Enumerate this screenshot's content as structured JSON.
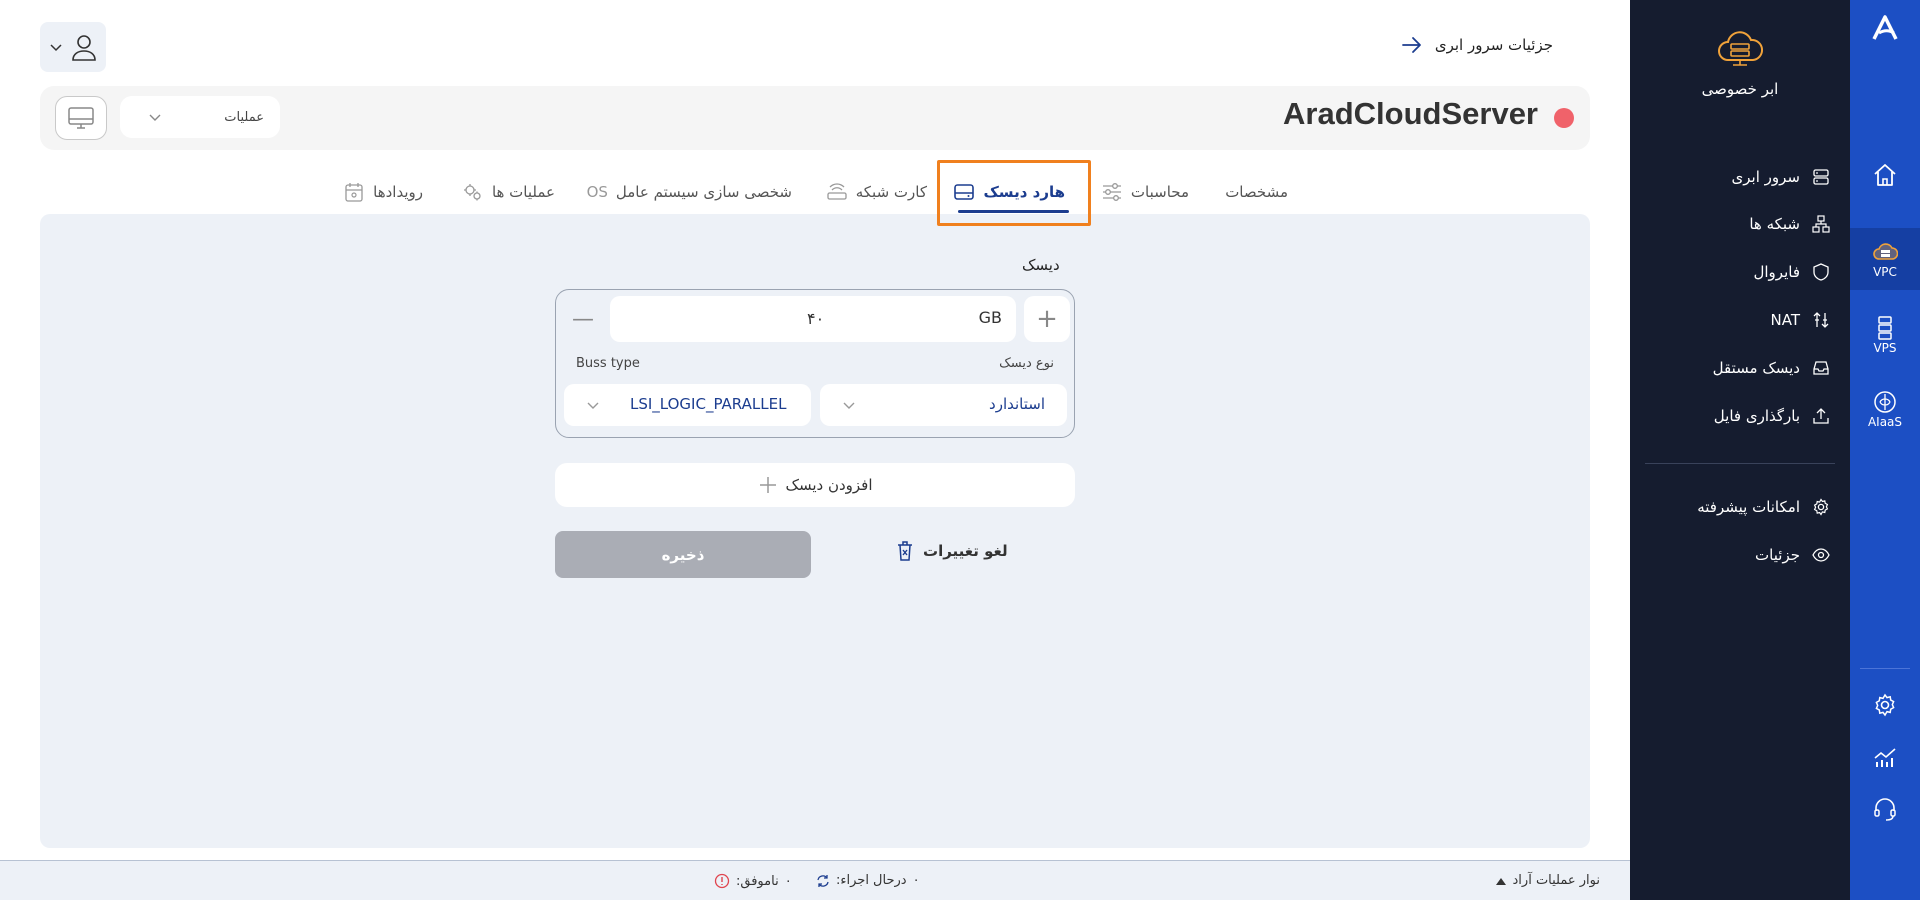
{
  "rail": {
    "items": [
      {
        "name": "home",
        "label": ""
      },
      {
        "name": "vpc",
        "label": "VPC"
      },
      {
        "name": "vps",
        "label": "VPS"
      },
      {
        "name": "aiaas",
        "label": "AIaaS"
      }
    ],
    "bottom_icons": [
      "settings-icon",
      "analytics-icon",
      "support-icon"
    ]
  },
  "sidebar": {
    "brand_label": "ابر خصوصی",
    "items": [
      {
        "label": "سرور ابری",
        "icon": "server-icon"
      },
      {
        "label": "شبکه ها",
        "icon": "network-icon"
      },
      {
        "label": "فایروال",
        "icon": "shield-icon"
      },
      {
        "label": "NAT",
        "icon": "nat-icon"
      },
      {
        "label": "دیسک مستقل",
        "icon": "disk-icon"
      },
      {
        "label": "بارگذاری فایل",
        "icon": "upload-icon"
      },
      {
        "label": "امکانات پیشرفته",
        "icon": "gear-icon"
      },
      {
        "label": "جزئیات",
        "icon": "eye-icon"
      }
    ]
  },
  "header": {
    "back_label": "جزئیات سرور ابری",
    "server_name": "AradCloudServer",
    "operations_label": "عملیات"
  },
  "tabs": [
    {
      "label": "مشخصات",
      "active": false
    },
    {
      "label": "محاسبات",
      "active": false
    },
    {
      "label": "هارد دیسک",
      "active": true
    },
    {
      "label": "کارت شبکه",
      "active": false
    },
    {
      "label": "شخصی سازی سیستم عامل",
      "active": false,
      "prefix": "OS"
    },
    {
      "label": "عملیات ها",
      "active": false
    },
    {
      "label": "رویدادها",
      "active": false
    }
  ],
  "disk": {
    "section_label": "دیسک",
    "size_value": "۴۰",
    "size_unit": "GB",
    "disk_type_label": "نوع دیسک",
    "disk_type_value": "استاندارد",
    "bus_type_label": "Buss type",
    "bus_type_value": "LSI_LOGIC_PARALLEL",
    "add_disk_label": "افزودن دیسک",
    "save_label": "ذخیره",
    "discard_label": "لغو تغییرات"
  },
  "footer": {
    "ops_bar_label": "نوار عملیات آراد",
    "running_label": "درحال اجراء:",
    "running_count": "۰",
    "failed_label": "ناموفق:",
    "failed_count": "۰"
  },
  "colors": {
    "rail_blue": "#1c4fc4",
    "sidebar_dark": "#151c2f",
    "active_tab": "#1c3d8f",
    "focus_orange": "#f0801e",
    "status_red": "#f0626a",
    "panel_bg": "#edf1f7"
  }
}
